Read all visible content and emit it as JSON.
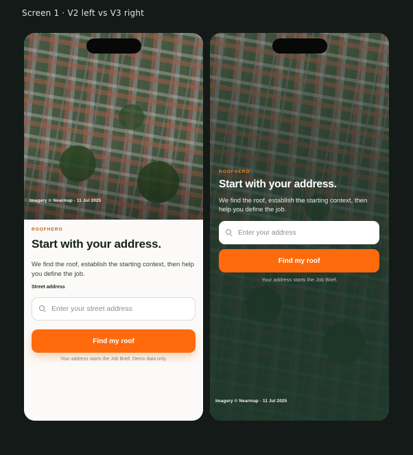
{
  "screen_title": "Screen 1 · V2 left vs V3 right",
  "v2": {
    "imagery_credit": "Imagery © Nearmap · 11 Jul 2025",
    "brand": "ROOFHERO",
    "headline": "Start with your address.",
    "body": "We find the roof, establish the starting context, then help you define the job.",
    "field_label": "Street address",
    "input_placeholder": "Enter your street address",
    "cta_label": "Find my roof",
    "note": "Your address starts the Job Brief. Demo data only."
  },
  "v3": {
    "brand": "ROOFHERO",
    "headline": "Start with your address.",
    "body": "We find the roof, establish the starting context, then help you define the job.",
    "input_placeholder": "Enter your address",
    "cta_label": "Find my roof",
    "note": "Your address starts the Job Brief.",
    "imagery_credit": "Imagery © Nearmap · 11 Jul 2025"
  },
  "colors": {
    "accent": "#ff6a0c",
    "brand_v2": "#c15a10",
    "brand_v3": "#f0801f",
    "canvas": "#141a17"
  }
}
